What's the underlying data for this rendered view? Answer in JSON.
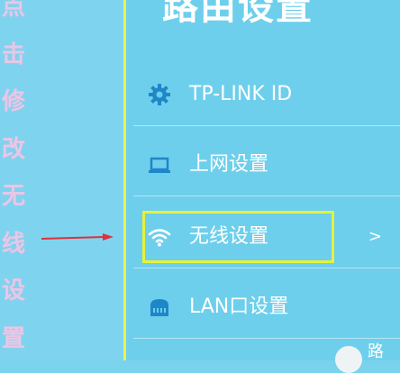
{
  "side_text": {
    "chars": [
      "点",
      "击",
      "修",
      "改",
      "无",
      "线",
      "设",
      "置"
    ]
  },
  "panel": {
    "title": "路由设置",
    "items": [
      {
        "label": "TP-LINK ID",
        "icon": "gear-icon"
      },
      {
        "label": "上网设置",
        "icon": "laptop-icon"
      },
      {
        "label": "无线设置",
        "icon": "wifi-icon",
        "chevron": ">"
      },
      {
        "label": "LAN口设置",
        "icon": "router-icon"
      }
    ]
  },
  "colors": {
    "panel_bg": "#6dcfeb",
    "highlight": "#e6f23a",
    "arrow": "#e0303a",
    "side_text": "#e6c8e8",
    "icon": "#1f86c8"
  },
  "corner": {
    "text": "路"
  }
}
